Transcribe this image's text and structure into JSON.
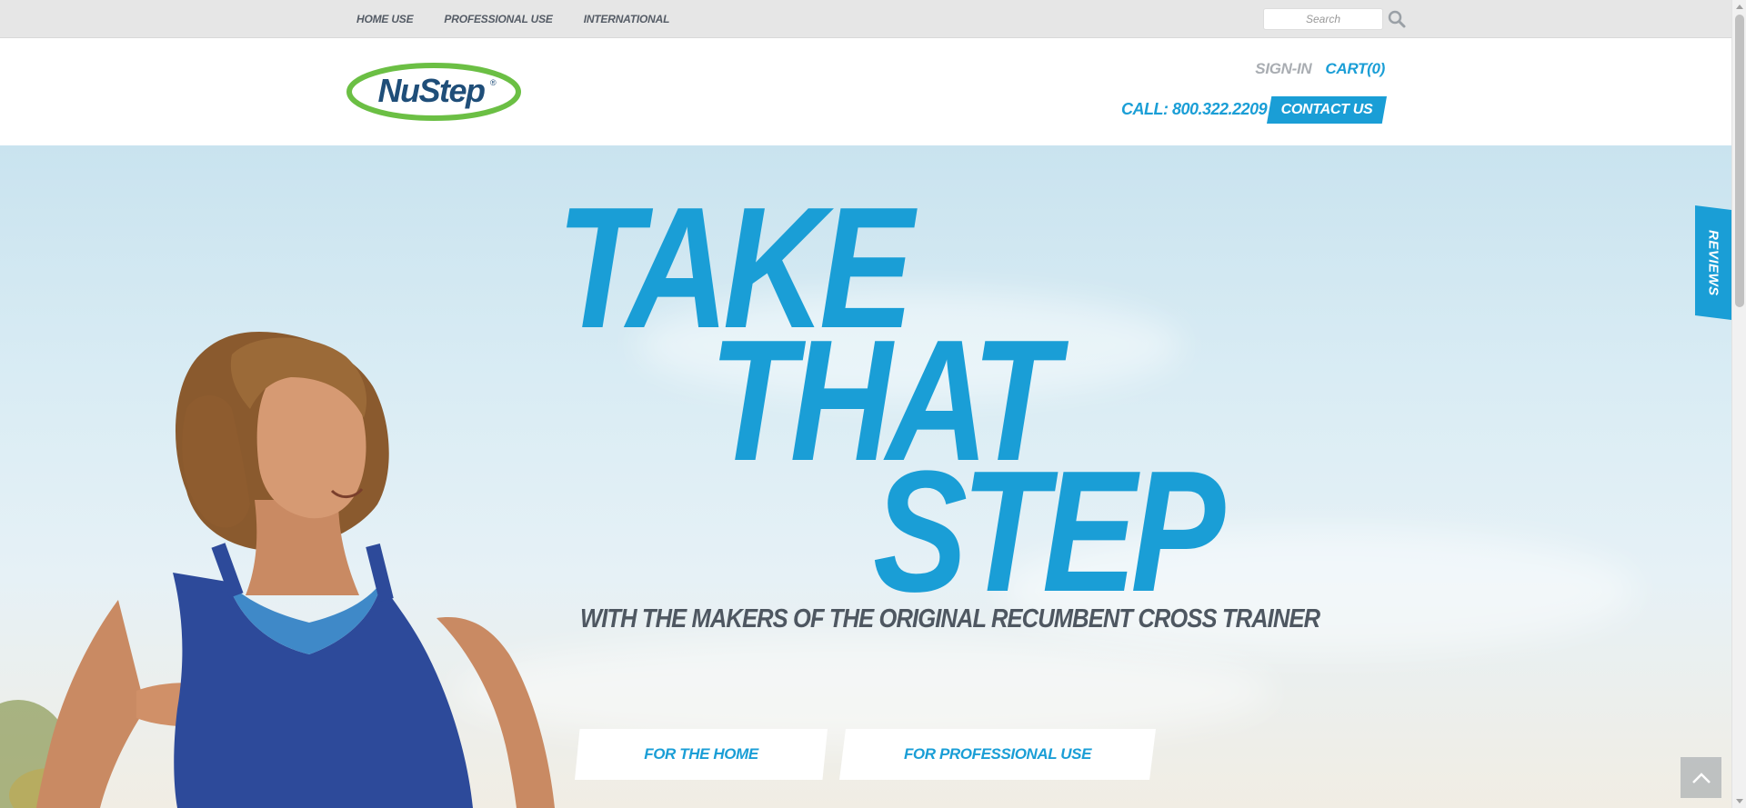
{
  "top_nav": {
    "items": [
      {
        "label": "HOME USE"
      },
      {
        "label": "PROFESSIONAL USE"
      },
      {
        "label": "INTERNATIONAL"
      }
    ],
    "search_placeholder": "Search",
    "search_icon": "search-icon"
  },
  "header": {
    "logo_text": "NuStep",
    "logo_mark": "®",
    "sign_in": "SIGN-IN",
    "cart": "CART(0)",
    "phone": "CALL: 800.322.2209",
    "contact_button": "CONTACT US"
  },
  "hero": {
    "headline_line1": "TAKE",
    "headline_line2": "THAT",
    "headline_line3": "STEP",
    "subheadline": "WITH THE MAKERS OF THE ORIGINAL RECUMBENT CROSS TRAINER",
    "cta_home": "FOR THE HOME",
    "cta_professional": "FOR PROFESSIONAL USE"
  },
  "reviews_tab": "REVIEWS",
  "back_to_top_icon": "chevron-up-icon",
  "colors": {
    "brand_blue": "#1a9ed6",
    "logo_green": "#6bbf44",
    "logo_navy": "#1f4e79",
    "topbar_bg": "#e6e6e6",
    "subhead_gray": "#4e5761"
  }
}
